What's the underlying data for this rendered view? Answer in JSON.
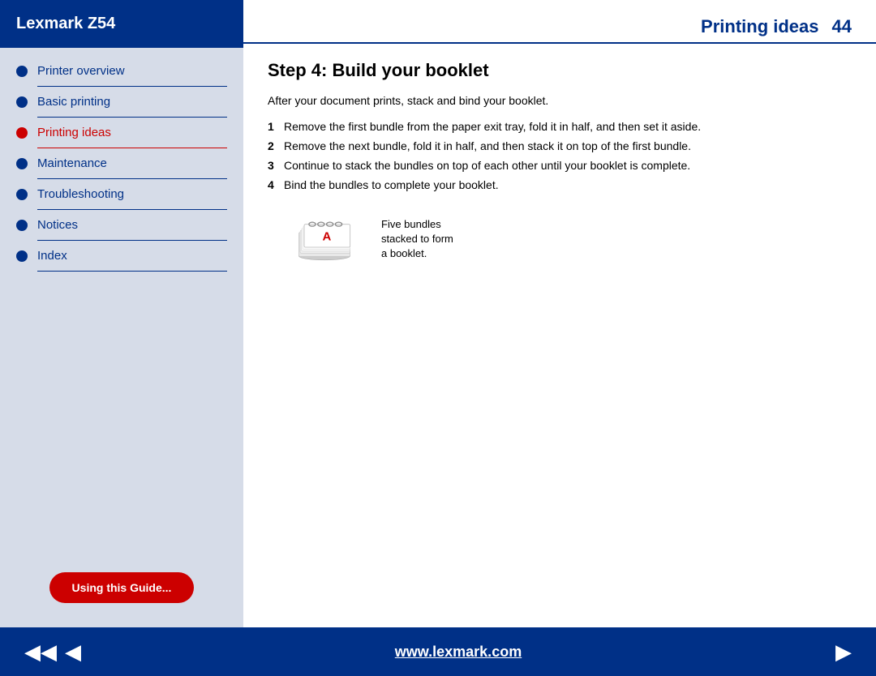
{
  "sidebar": {
    "header": "Lexmark Z54",
    "nav_items": [
      {
        "id": "printer-overview",
        "label": "Printer overview",
        "active": false
      },
      {
        "id": "basic-printing",
        "label": "Basic printing",
        "active": false
      },
      {
        "id": "printing-ideas",
        "label": "Printing ideas",
        "active": true
      },
      {
        "id": "maintenance",
        "label": "Maintenance",
        "active": false
      },
      {
        "id": "troubleshooting",
        "label": "Troubleshooting",
        "active": false
      },
      {
        "id": "notices",
        "label": "Notices",
        "active": false
      },
      {
        "id": "index",
        "label": "Index",
        "active": false
      }
    ],
    "using_guide_btn": "Using this\nGuide..."
  },
  "content": {
    "page_title": "Printing ideas",
    "page_number": "44",
    "step_title": "Step 4: Build your booklet",
    "intro_text": "After your document prints, stack and bind your booklet.",
    "steps": [
      {
        "num": "1",
        "text": "Remove the first bundle from the paper exit tray, fold it in half, and then set it aside."
      },
      {
        "num": "2",
        "text": "Remove the next bundle, fold it in half, and then stack it on top of the first bundle."
      },
      {
        "num": "3",
        "text": "Continue to stack the bundles on top of each other until your booklet is complete."
      },
      {
        "num": "4",
        "text": "Bind the bundles to complete your booklet."
      }
    ],
    "illustration_caption": "Five bundles\nstacked to form\na booklet."
  },
  "bottom_bar": {
    "url": "www.lexmark.com",
    "arrow_left_double": "◀◀",
    "arrow_left": "◀",
    "arrow_right": "▶"
  }
}
